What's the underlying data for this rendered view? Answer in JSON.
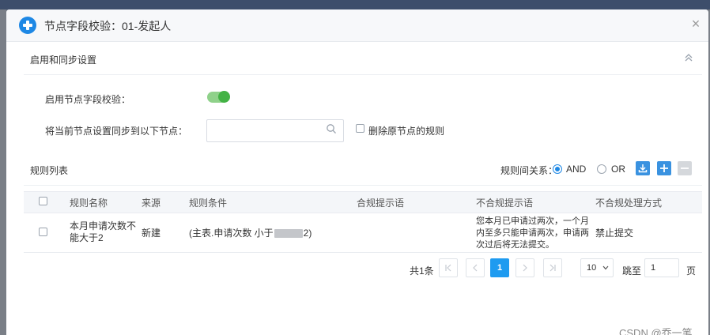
{
  "dialog": {
    "title": "节点字段校验：01-发起人",
    "close": "×"
  },
  "sync_section": {
    "title": "启用和同步设置",
    "enable_label": "启用节点字段校验：",
    "enable_on": true,
    "sync_label": "将当前节点设置同步到以下节点：",
    "search_value": "",
    "delete_label": "删除原节点的规则"
  },
  "rules": {
    "title": "规则列表",
    "relation_label": "规则间关系：",
    "relation_and": "AND",
    "relation_or": "OR",
    "relation_selected": "AND",
    "columns": [
      "规则名称",
      "来源",
      "规则条件",
      "合规提示语",
      "不合规提示语",
      "不合规处理方式"
    ],
    "rows": [
      {
        "name_line1": "本月申请次数不",
        "name_line2": "能大于2",
        "source": "新建",
        "condition_pre": "(主表.申请次数 小于",
        "condition_post": "2)",
        "compliant_tip": "",
        "noncompliant_line1": "您本月已申请过两次，一个月",
        "noncompliant_line2": "内至多只能申请两次，申请两",
        "noncompliant_line3": "次过后将无法提交。",
        "handling": "禁止提交"
      }
    ]
  },
  "pagination": {
    "total": "共1条",
    "current": "1",
    "page_size": "10",
    "jump_label": "跳至",
    "jump_value": "1",
    "page_label": "页"
  },
  "watermark": "CSDN @乔一笔"
}
